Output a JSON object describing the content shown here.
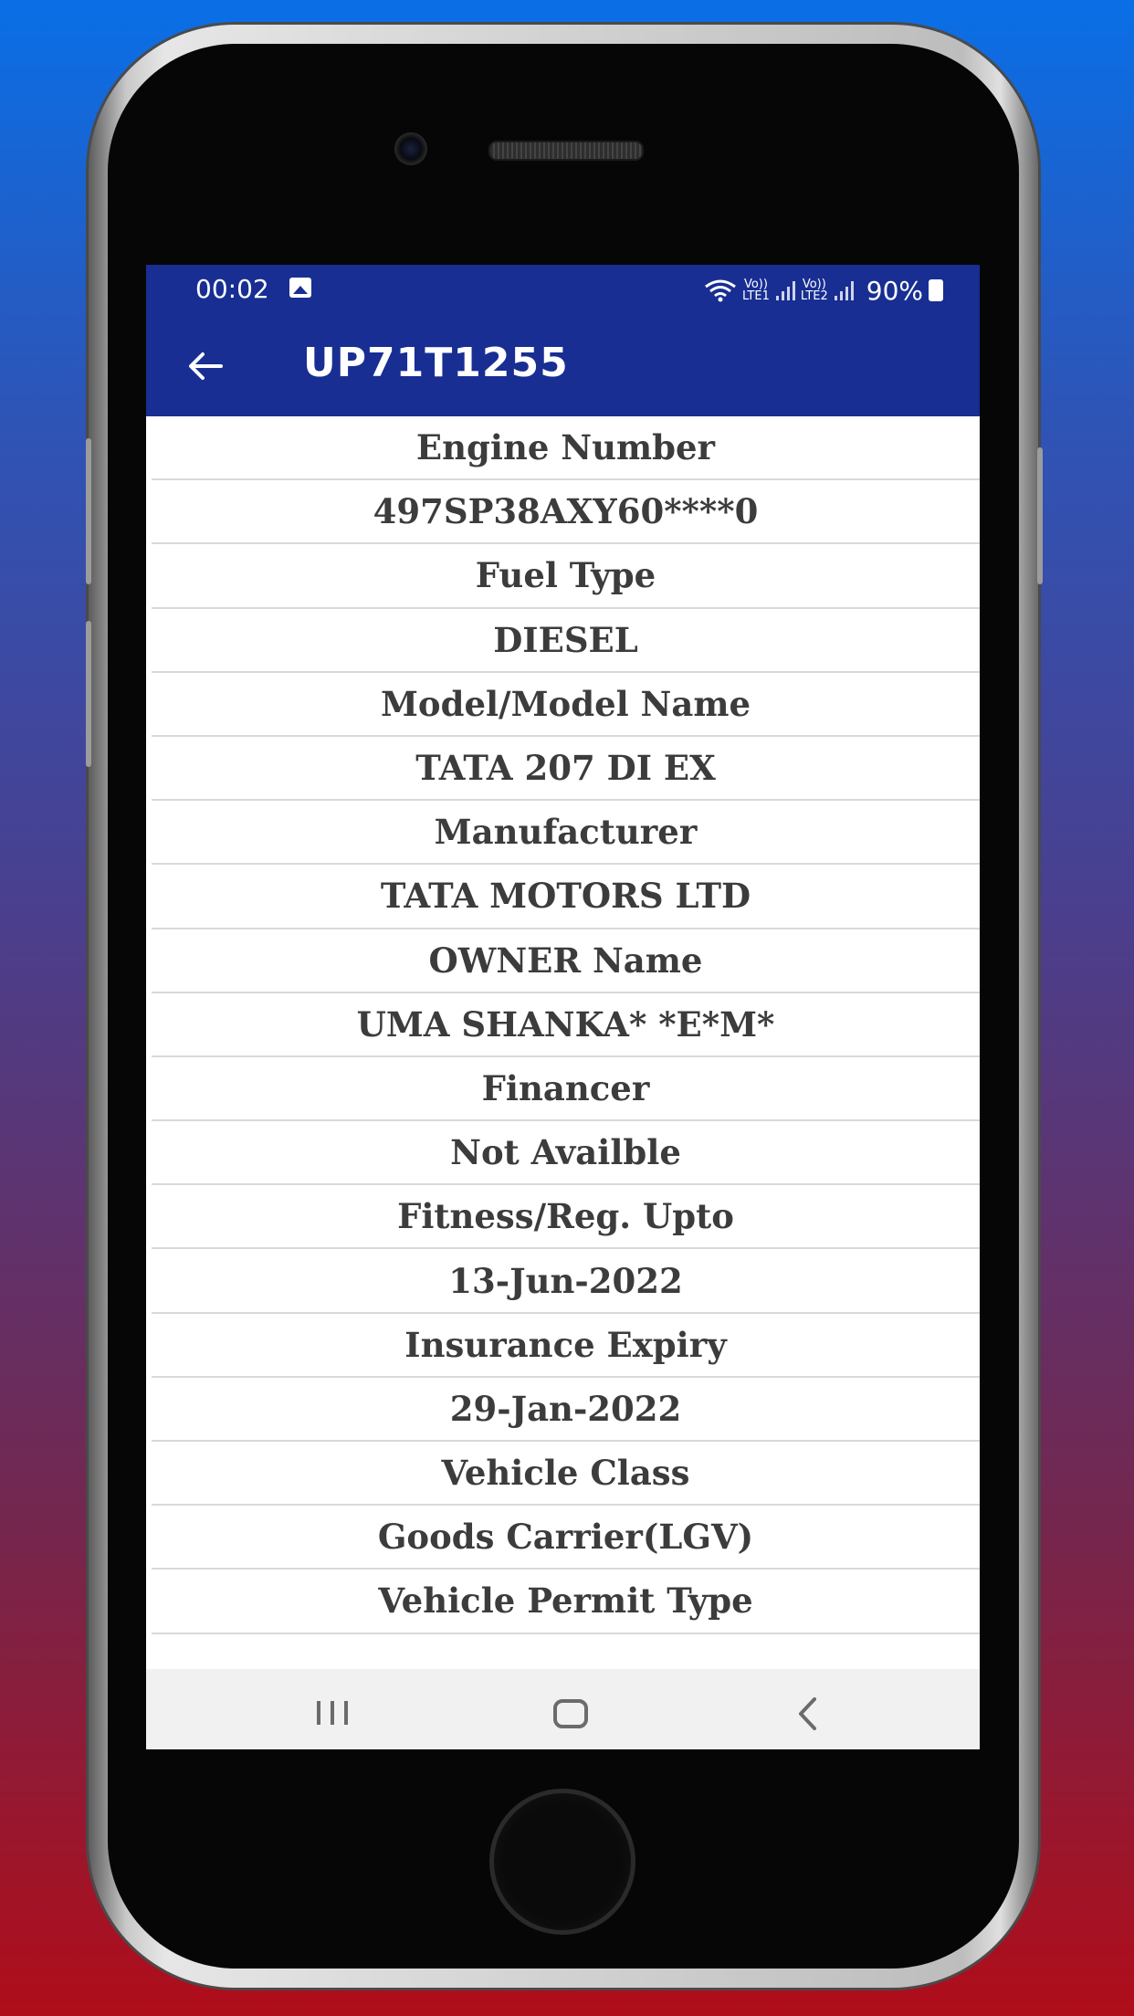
{
  "status_bar": {
    "time": "00:02",
    "sim1_label": "Vo))\nLTE1",
    "sim2_label": "Vo))\nLTE2",
    "battery": "90%"
  },
  "app_bar": {
    "title": "UP71T1255"
  },
  "details": [
    "Engine Number",
    "497SP38AXY60****0",
    "Fuel Type",
    "DIESEL",
    "Model/Model Name",
    "TATA 207 DI EX",
    "Manufacturer",
    "TATA MOTORS LTD",
    "OWNER Name",
    "UMA SHANKA* *E*M*",
    "Financer",
    "Not Availble",
    "Fitness/Reg. Upto",
    "13-Jun-2022",
    "Insurance Expiry",
    "29-Jan-2022",
    "Vehicle Class",
    "Goods Carrier(LGV)",
    "Vehicle Permit Type"
  ],
  "colors": {
    "app_bar": "#182e93",
    "text": "#3c3c3c",
    "divider": "#d9d9d9"
  }
}
